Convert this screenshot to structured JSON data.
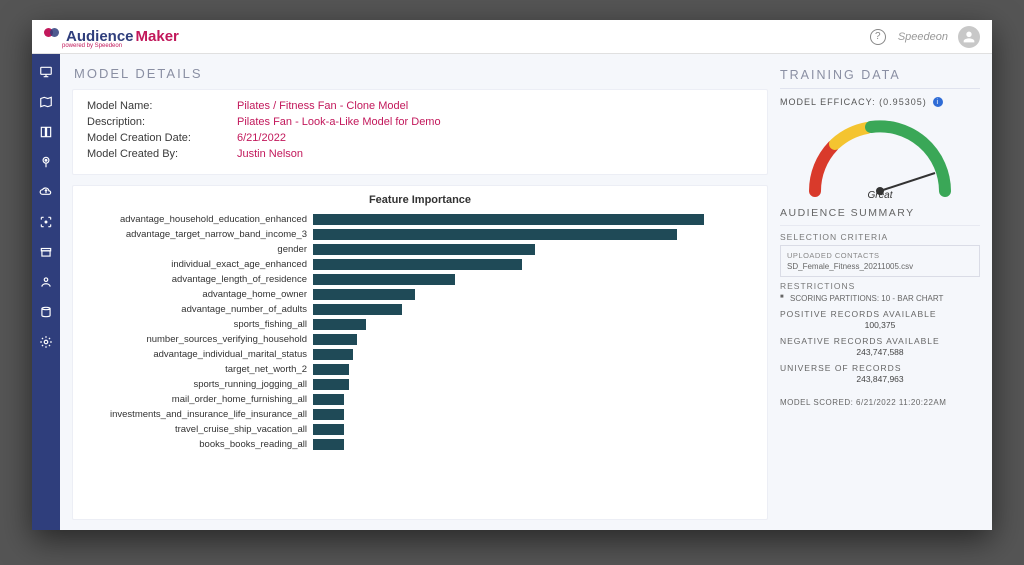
{
  "app": {
    "brand1": "Audience",
    "brand2": "Maker",
    "tagline": "powered by Speedeon"
  },
  "topbar": {
    "username": "Speedeon"
  },
  "page": {
    "title": "MODEL DETAILS"
  },
  "model": {
    "name_label": "Model Name:",
    "name_value": "Pilates / Fitness Fan - Clone Model",
    "desc_label": "Description:",
    "desc_value": "Pilates Fan - Look-a-Like Model for Demo",
    "date_label": "Model Creation Date:",
    "date_value": "6/21/2022",
    "by_label": "Model Created By:",
    "by_value": "Justin Nelson"
  },
  "training": {
    "title": "TRAINING DATA",
    "efficacy_label": "MODEL EFFICACY: (0.95305)",
    "gauge_label": "Great",
    "summary_title": "AUDIENCE SUMMARY",
    "selection_title": "SELECTION CRITERIA",
    "upload_label": "UPLOADED CONTACTS",
    "upload_file": "SD_Female_Fitness_20211005.csv",
    "restrictions_title": "RESTRICTIONS",
    "restriction_item": "SCORING PARTITIONS: 10 - BAR CHART",
    "pos_label": "POSITIVE RECORDS AVAILABLE",
    "pos_value": "100,375",
    "neg_label": "NEGATIVE RECORDS AVAILABLE",
    "neg_value": "243,747,588",
    "uni_label": "UNIVERSE OF RECORDS",
    "uni_value": "243,847,963",
    "scored_label": "MODEL SCORED: 6/21/2022 11:20:22AM"
  },
  "chart_data": {
    "type": "bar",
    "title": "Feature Importance",
    "orientation": "horizontal",
    "xlabel": "",
    "ylabel": "",
    "xlim": [
      0,
      100
    ],
    "categories": [
      "advantage_household_education_enhanced",
      "advantage_target_narrow_band_income_3",
      "gender",
      "individual_exact_age_enhanced",
      "advantage_length_of_residence",
      "advantage_home_owner",
      "advantage_number_of_adults",
      "sports_fishing_all",
      "number_sources_verifying_household",
      "advantage_individual_marital_status",
      "target_net_worth_2",
      "sports_running_jogging_all",
      "mail_order_home_furnishing_all",
      "investments_and_insurance_life_insurance_all",
      "travel_cruise_ship_vacation_all",
      "books_books_reading_all"
    ],
    "values": [
      88,
      82,
      50,
      47,
      32,
      23,
      20,
      12,
      10,
      9,
      8,
      8,
      7,
      7,
      7,
      7
    ]
  }
}
